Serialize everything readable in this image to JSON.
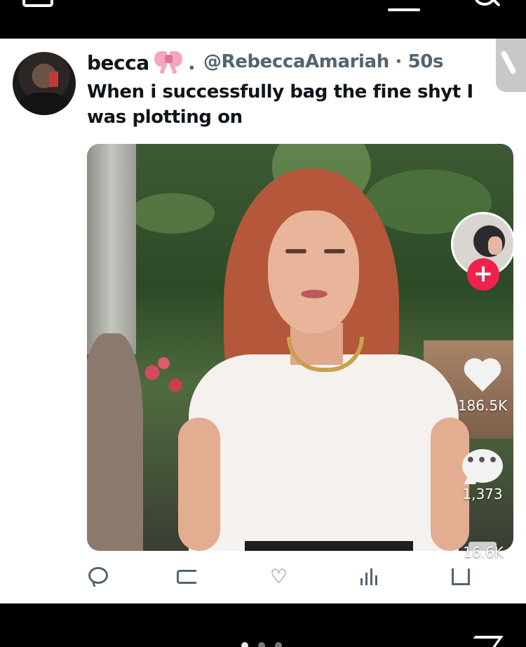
{
  "post": {
    "display_name": "becca",
    "separator": ".",
    "handle_time": "@RebeccaAmariah · 50s",
    "text": "When i successfully bag the fine shyt I was plotting on"
  },
  "overlay": {
    "likes": "186.5K",
    "comments": "1,373",
    "shares": "16.6K",
    "follow_symbol": "+",
    "more_dots": "•••"
  },
  "colors": {
    "tiktok_follow_red": "#f0214e",
    "secondary_text": "#536471",
    "primary_text": "#0f1419"
  }
}
